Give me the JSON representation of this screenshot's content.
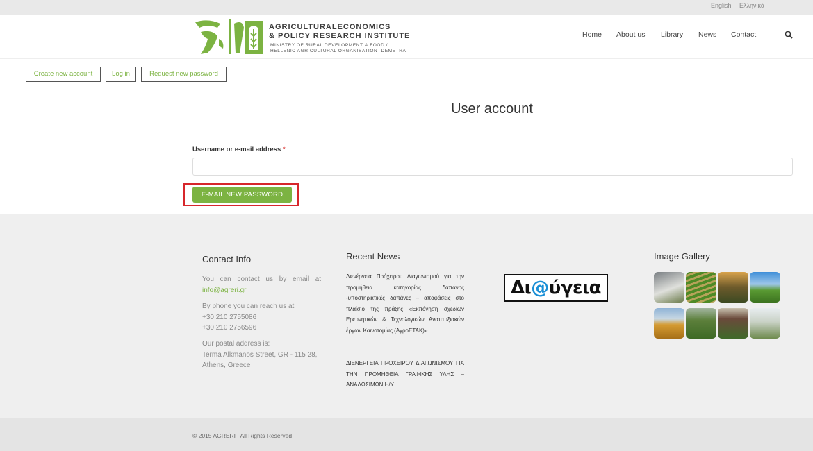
{
  "language_bar": {
    "english": "English",
    "greek": "Ελληνικά"
  },
  "logo": {
    "title_line1": "AGRICULTURALECONOMICS",
    "title_line2": "& POLICY RESEARCH INSTITUTE",
    "sub_line1": "MINISTRY OF RURAL DEVELOPMENT & FOOD /",
    "sub_line2": "HELLENIC AGRICULTURAL ORGANISATION- DEMETRA"
  },
  "nav": {
    "home": "Home",
    "about": "About us",
    "library": "Library",
    "news": "News",
    "contact": "Contact"
  },
  "tabs": {
    "create": "Create new account",
    "login": "Log in",
    "request": "Request new password"
  },
  "page_title": "User account",
  "form": {
    "label": "Username or e-mail address",
    "required_mark": "*",
    "input_value": "",
    "submit_label": "E-MAIL NEW PASSWORD"
  },
  "footer": {
    "contact": {
      "title": "Contact Info",
      "email_intro": "You can contact us by email at",
      "email": "info@agreri.gr",
      "phone_intro": "By phone you can reach us at",
      "phone1": "+30 210 2755086",
      "phone2": "+30 210 2756596",
      "postal_intro": "Our postal address is:",
      "address1": "Terma Alkmanos Street, GR - 115 28,",
      "address2": "Athens, Greece"
    },
    "news": {
      "title": "Recent News",
      "item1": "Διενέργεια Πρόχειρου Διαγωνισμού για την προμήθεια κατηγορίας δαπάνης -υποστηρικτικές δαπάνες – αποφάσεις στο πλαίσιο της πράξης «Εκπόνηση σχεδίων Ερευνητικών & Τεχνολογικών Αναπτυξιακών έργων Καινοτομίας (ΑγροΕΤΑΚ)»",
      "item2": "ΔΙΕΝΕΡΓΕΙΑ ΠΡΟΧΕΙΡΟΥ ΔΙΑΓΩΝΙΣΜΟΥ ΓΙΑ ΤΗΝ ΠΡΟΜΗΘΕΙΑ ΓΡΑΦΙΚΗΣ ΥΛΗΣ – ΑΝΑΛΩΣΙΜΩΝ Η/Υ"
    },
    "diavgeia": {
      "pre": "Δι",
      "at": "@",
      "post": "ύγεια"
    },
    "gallery": {
      "title": "Image Gallery"
    },
    "copyright": "© 2015 AGRERI | All Rights Reserved"
  },
  "colors": {
    "accent": "#7cb342",
    "highlight": "#d7262b",
    "required": "#d9322f"
  }
}
